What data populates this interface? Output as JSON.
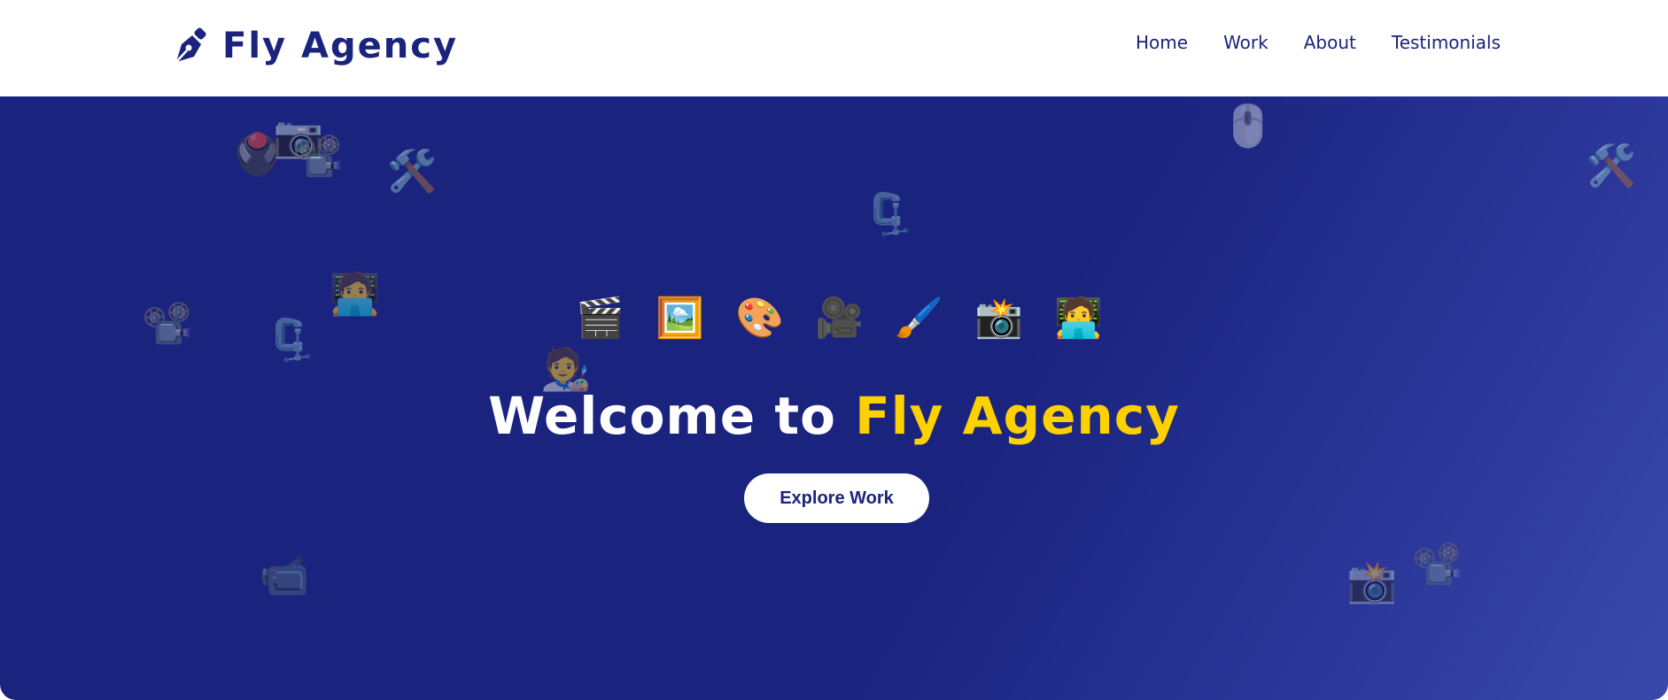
{
  "brand": {
    "icon": "fountain-pen-icon",
    "name": "Fly Agency",
    "color": "#1a237e"
  },
  "nav": {
    "items": [
      {
        "label": "Home"
      },
      {
        "label": "Work"
      },
      {
        "label": "About"
      },
      {
        "label": "Testimonials"
      }
    ]
  },
  "hero": {
    "background": "#1a237e",
    "title_prefix": "Welcome to ",
    "title_accent": "Fly Agency",
    "accent_color": "#fdd000",
    "cta_label": "Explore Work",
    "icon_row": [
      {
        "icon": "clapper-board-icon",
        "glyph": "🎬"
      },
      {
        "icon": "framed-picture-icon",
        "glyph": "🖼️"
      },
      {
        "icon": "artist-palette-icon",
        "glyph": "🎨"
      },
      {
        "icon": "movie-camera-icon",
        "glyph": "🎥"
      },
      {
        "icon": "paintbrush-icon",
        "glyph": "🖌️"
      },
      {
        "icon": "camera-flash-icon",
        "glyph": "📸"
      },
      {
        "icon": "technologist-icon",
        "glyph": "🧑‍💻"
      }
    ],
    "floating_icons": [
      {
        "icon": "trackball-icon",
        "glyph": "🖲️"
      },
      {
        "icon": "camera-icon",
        "glyph": "📷"
      },
      {
        "icon": "film-projector-icon",
        "glyph": "📽️"
      },
      {
        "icon": "hammer-wrench-icon",
        "glyph": "🛠️"
      },
      {
        "icon": "computer-mouse-icon",
        "glyph": "🖱️"
      },
      {
        "icon": "hammer-wrench-icon",
        "glyph": "🛠️"
      },
      {
        "icon": "clamp-icon",
        "glyph": "🗜️"
      },
      {
        "icon": "technologist-icon",
        "glyph": "🧑‍💻"
      },
      {
        "icon": "film-projector-icon",
        "glyph": "📽️"
      },
      {
        "icon": "clamp-icon",
        "glyph": "🗜️"
      },
      {
        "icon": "artist-icon",
        "glyph": "🧑‍🎨"
      },
      {
        "icon": "video-camera-icon",
        "glyph": "📹"
      },
      {
        "icon": "camera-flash-icon",
        "glyph": "📸"
      },
      {
        "icon": "film-projector-icon",
        "glyph": "📽️"
      }
    ]
  }
}
